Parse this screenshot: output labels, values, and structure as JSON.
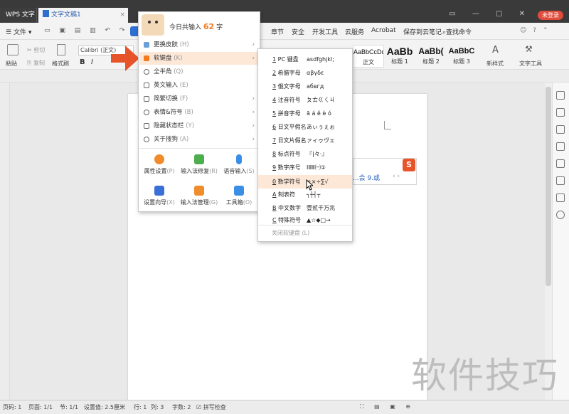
{
  "titlebar": {
    "app_tab": "WPS 文字",
    "doc_tab": "文字文稿1",
    "login": "未登录"
  },
  "menu": {
    "file": "文件",
    "items": [
      "章节",
      "安全",
      "开发工具",
      "云服务",
      "Acrobat",
      "保存到云笔记"
    ],
    "search": "查找命令"
  },
  "ribbon": {
    "paste": "粘贴",
    "cut": "剪切",
    "copy": "复制",
    "format_painter": "格式刷",
    "font_name": "Calibri (正文)",
    "styles": [
      {
        "sample": "AaBbCcDd",
        "label": "正文"
      },
      {
        "sample": "AaBb",
        "label": "标题 1"
      },
      {
        "sample": "AaBb(",
        "label": "标题 2"
      },
      {
        "sample": "AaBbC",
        "label": "标题 3"
      }
    ],
    "new_style": "新样式",
    "text_tools": "文字工具"
  },
  "ime_menu": {
    "today_label": "今日共输入",
    "today_count": "62",
    "today_unit": "字",
    "items": [
      {
        "label": "更换皮肤",
        "hotkey": "(H)",
        "color": "#6aa0d8"
      },
      {
        "label": "软键盘",
        "hotkey": "(K)",
        "color": "#f27b1e"
      },
      {
        "label": "全半角",
        "hotkey": "(Q)",
        "color": "#666"
      },
      {
        "label": "英文输入",
        "hotkey": "(E)",
        "color": "#666"
      },
      {
        "label": "简繁切换",
        "hotkey": "(F)",
        "color": "#666"
      },
      {
        "label": "表情&符号",
        "hotkey": "(B)",
        "color": "#666"
      },
      {
        "label": "隐藏状态栏",
        "hotkey": "(Y)",
        "color": "#666"
      },
      {
        "label": "关于搜狗",
        "hotkey": "(A)",
        "color": "#666"
      }
    ],
    "grid": [
      {
        "label": "属性设置",
        "hotkey": "(P)",
        "color": "#f08c2a"
      },
      {
        "label": "输入法修复",
        "hotkey": "(R)",
        "color": "#4cae4c"
      },
      {
        "label": "语音输入",
        "hotkey": "(S)",
        "color": "#3a8ee6"
      },
      {
        "label": "设置向导",
        "hotkey": "(X)",
        "color": "#3a6fd8"
      },
      {
        "label": "输入法管理",
        "hotkey": "(G)",
        "color": "#f08c2a"
      },
      {
        "label": "工具箱",
        "hotkey": "(O)",
        "color": "#3a8ee6"
      }
    ]
  },
  "keyboard_menu": {
    "items": [
      {
        "key": "1",
        "label": "PC 键盘",
        "sample": "asdfghjkl;"
      },
      {
        "key": "2",
        "label": "希腊字母",
        "sample": "αβγδε"
      },
      {
        "key": "3",
        "label": "俄文字母",
        "sample": "абвгд"
      },
      {
        "key": "4",
        "label": "注音符号",
        "sample": "ㄆㄊㄍㄑㄐ"
      },
      {
        "key": "5",
        "label": "拼音字母",
        "sample": "ā á ě è ó"
      },
      {
        "key": "6",
        "label": "日文平假名",
        "sample": "あぃぅぇぉ"
      },
      {
        "key": "7",
        "label": "日文片假名",
        "sample": "ァィゥヴェ"
      },
      {
        "key": "8",
        "label": "标点符号",
        "sample": "『|々·』"
      },
      {
        "key": "9",
        "label": "数字序号",
        "sample": "ⅠⅡⅢ㈠①"
      },
      {
        "key": "0",
        "label": "数学符号",
        "sample": "±×÷∑√"
      },
      {
        "key": "A",
        "label": "制表符",
        "sample": "┐┼┤┬"
      },
      {
        "key": "B",
        "label": "中文数字",
        "sample": "壹贰千万兆"
      },
      {
        "key": "C",
        "label": "特殊符号",
        "sample": "▲☆◆□→"
      }
    ],
    "close": "关闭软键盘 (L)"
  },
  "candidate_bar": {
    "text": "...会  9.或"
  },
  "status": {
    "page_code": "页码: 1",
    "pages": "页面: 1/1",
    "section": "节: 1/1",
    "setting": "设置值: 2.5厘米",
    "row": "行: 1",
    "col": "列: 3",
    "words": "字数: 2",
    "spell": "拼写检查"
  },
  "watermark": "软件技巧",
  "colors": {
    "accent": "#f27b1e",
    "login": "#e04b3b",
    "highlight": "#fde7d7"
  }
}
